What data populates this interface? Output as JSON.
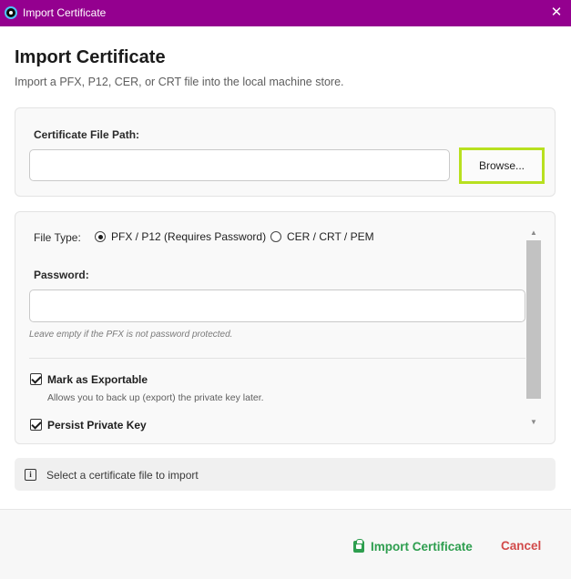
{
  "window": {
    "title": "Import Certificate",
    "close_icon": "close-icon"
  },
  "header": {
    "title": "Import Certificate",
    "subtitle": "Import a PFX, P12, CER, or CRT file into the local machine store."
  },
  "file_section": {
    "label": "Certificate File Path:",
    "path_value": "",
    "browse_label": "Browse..."
  },
  "options": {
    "file_type_label": "File Type:",
    "file_types": [
      {
        "label": "PFX / P12 (Requires Password)",
        "selected": true
      },
      {
        "label": "CER / CRT / PEM",
        "selected": false
      }
    ],
    "password_label": "Password:",
    "password_value": "",
    "password_hint": "Leave empty if the PFX is not password protected.",
    "checkboxes": [
      {
        "label": "Mark as Exportable",
        "checked": true,
        "description": "Allows you to back up (export) the private key later."
      },
      {
        "label": "Persist Private Key",
        "checked": true,
        "description": ""
      }
    ]
  },
  "status": {
    "icon": "info-icon",
    "text": "Select a certificate file to import"
  },
  "footer": {
    "import_label": "Import Certificate",
    "import_icon": "certificate-icon",
    "cancel_label": "Cancel"
  },
  "colors": {
    "titlebar": "#94008f",
    "accent_green": "#2e9e4f",
    "cancel_red": "#d24a4a",
    "focus_highlight": "#b8e01f"
  }
}
